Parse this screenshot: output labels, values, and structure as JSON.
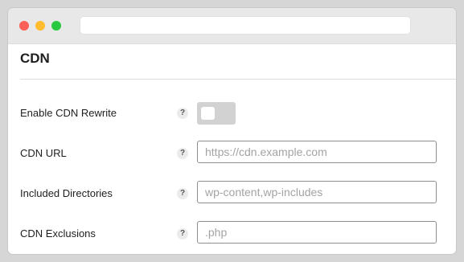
{
  "section": {
    "title": "CDN"
  },
  "settings": [
    {
      "label": "Enable CDN Rewrite",
      "help": "?",
      "type": "toggle",
      "enabled": false
    },
    {
      "label": "CDN URL",
      "help": "?",
      "type": "text",
      "value": "",
      "placeholder": "https://cdn.example.com"
    },
    {
      "label": "Included Directories",
      "help": "?",
      "type": "text",
      "value": "",
      "placeholder": "wp-content,wp-includes"
    },
    {
      "label": "CDN Exclusions",
      "help": "?",
      "type": "text",
      "value": "",
      "placeholder": ".php"
    }
  ],
  "colors": {
    "toggle_off": "#d2d2d2",
    "close": "#fe5f57",
    "minimize": "#febc2e",
    "zoom": "#28c840"
  }
}
